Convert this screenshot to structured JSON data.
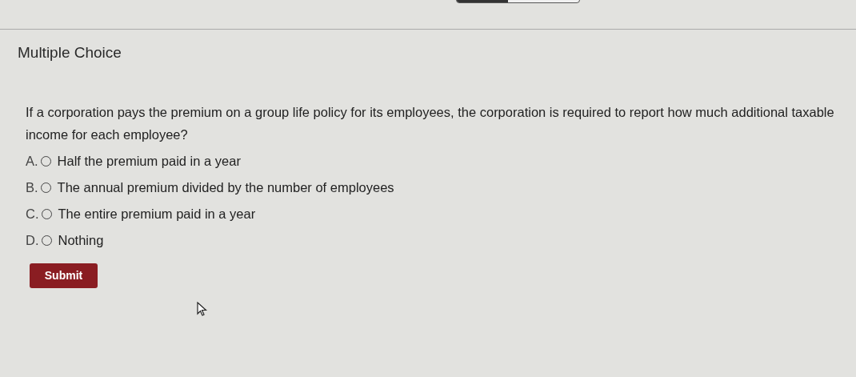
{
  "header": {
    "progress": {
      "level": 0.42
    }
  },
  "title": "Multiple Choice",
  "question": "If a corporation pays the premium on a group life policy for its employees, the corporation is required to report how much additional taxable income for each employee?",
  "options": [
    {
      "letter": "A.",
      "text": "Half the premium paid in a year",
      "selected": false
    },
    {
      "letter": "B.",
      "text": "The annual premium divided by the number of employees",
      "selected": false
    },
    {
      "letter": "C.",
      "text": "The entire premium paid in a year",
      "selected": false
    },
    {
      "letter": "D.",
      "text": "Nothing",
      "selected": false
    }
  ],
  "submit_button": "Submit"
}
